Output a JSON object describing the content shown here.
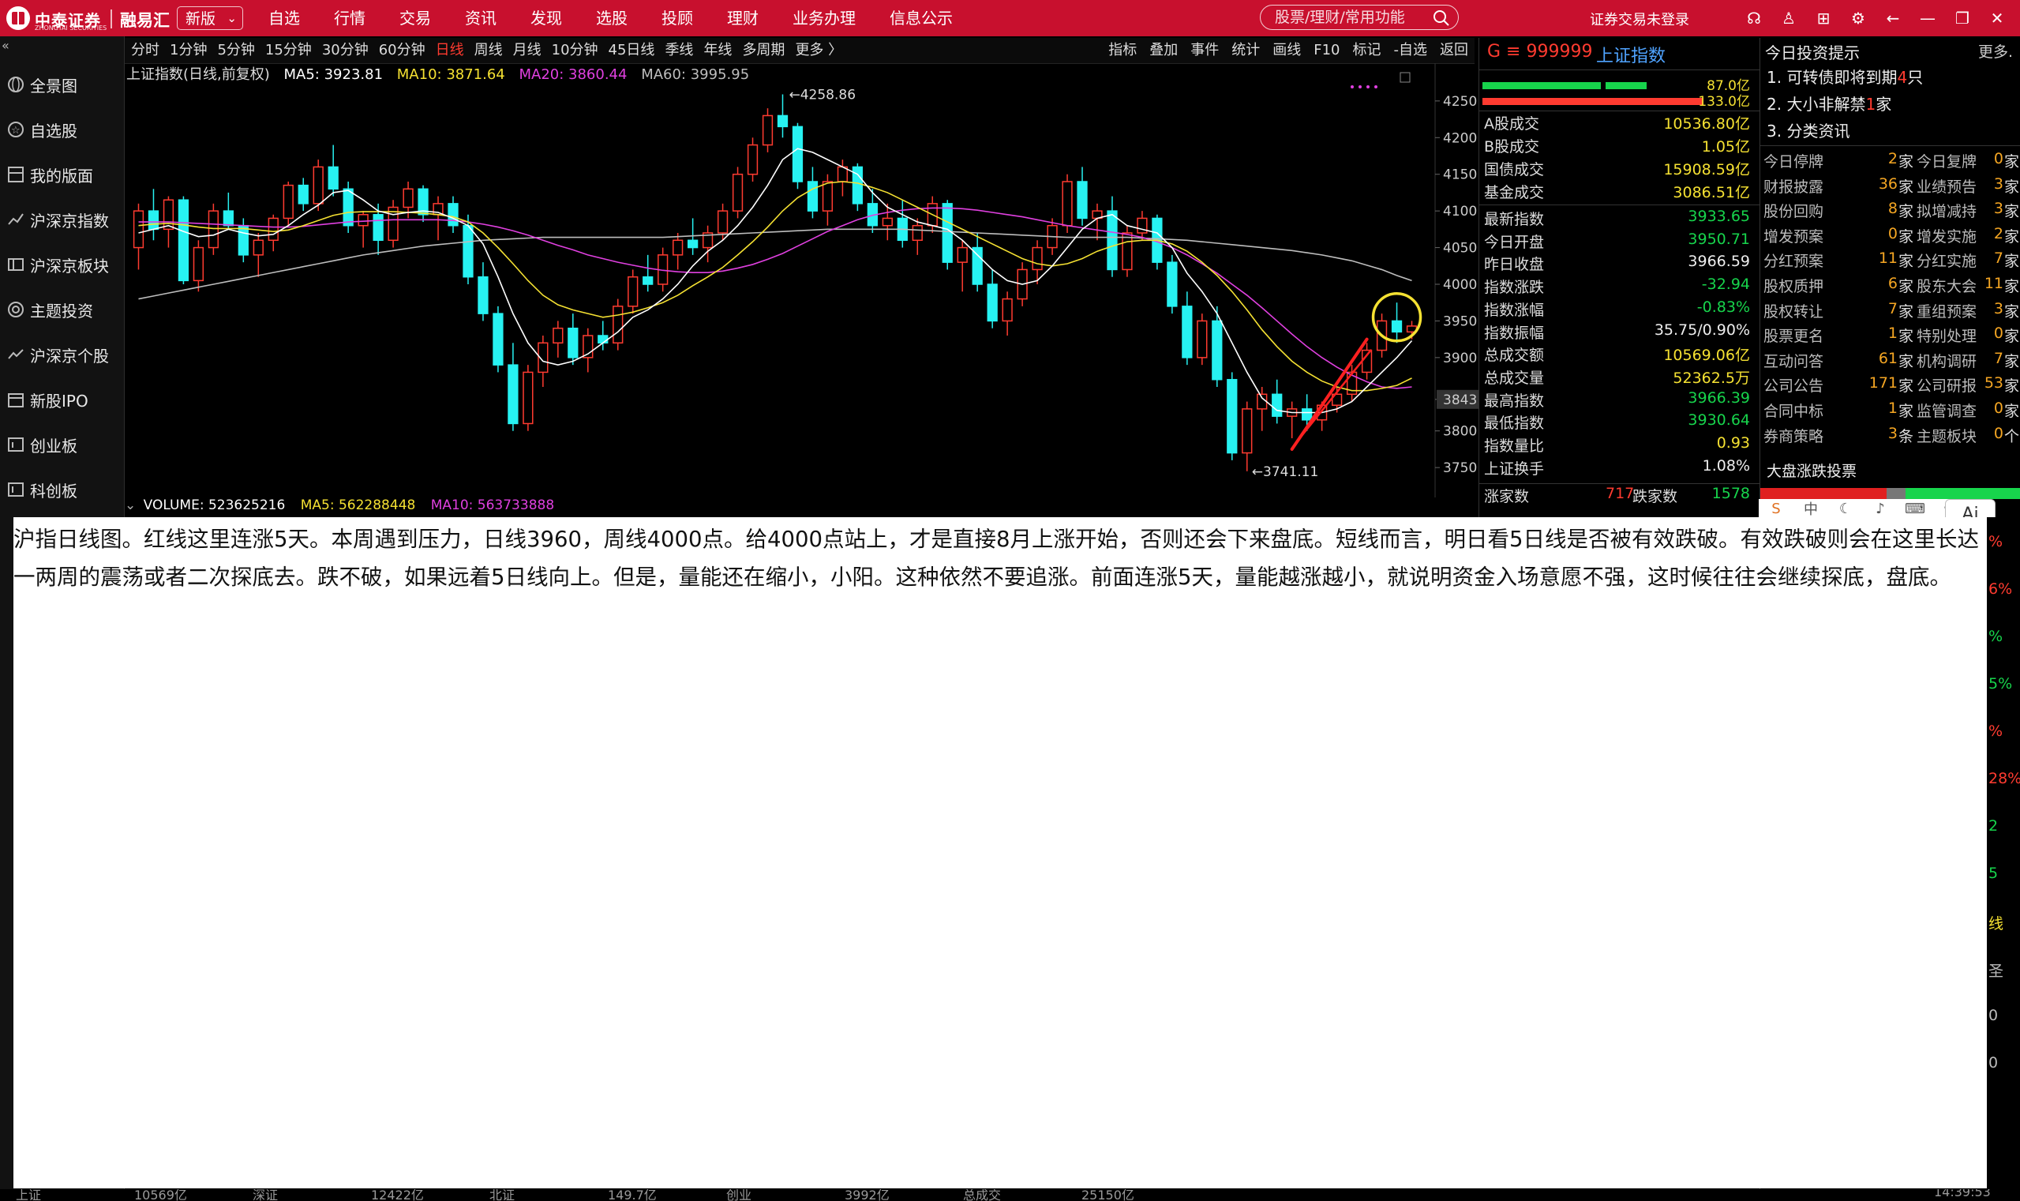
{
  "app": {
    "brand": "中泰证券",
    "brand_sub": "ZHONGTAI SECURITIES",
    "brand2": "融易汇",
    "version_select": "新版",
    "menu": [
      "自选",
      "行情",
      "交易",
      "资讯",
      "发现",
      "选股",
      "投顾",
      "理财",
      "业务办理",
      "信息公示"
    ],
    "search_placeholder": "股票/理财/常用功能",
    "login_status": "证券交易未登录"
  },
  "sidebar": {
    "items": [
      "全景图",
      "自选股",
      "我的版面",
      "沪深京指数",
      "沪深京板块",
      "主题投资",
      "沪深京个股",
      "新股IPO",
      "创业板",
      "科创板"
    ]
  },
  "chart_toolbar": {
    "periods": [
      "分时",
      "1分钟",
      "5分钟",
      "15分钟",
      "30分钟",
      "60分钟",
      "日线",
      "周线",
      "月线",
      "10分钟",
      "45日线",
      "季线",
      "年线",
      "多周期",
      "更多 〉"
    ],
    "active_period": "日线",
    "tools": [
      "指标",
      "叠加",
      "事件",
      "统计",
      "画线",
      "F10",
      "标记",
      "-自选",
      "返回"
    ]
  },
  "chart_header": {
    "title": "上证指数(日线,前复权)",
    "ma5": "MA5: 3923.81",
    "ma10": "MA10: 3871.64",
    "ma20": "MA20: 3860.44",
    "ma60": "MA60: 3995.95",
    "volume": "VOLUME: 523625216",
    "vol_ma5": "MA5: 562288448",
    "vol_ma10": "MA10: 563733888"
  },
  "chart_data": {
    "type": "candlestick",
    "ylim": [
      3720,
      4280
    ],
    "y_ticks": [
      4250,
      4200,
      4150,
      4100,
      4050,
      4000,
      3950,
      3900,
      3843.0,
      3800,
      3750
    ],
    "current_price_label": "3843.0",
    "high_label": "4258.86",
    "low_label": "3741.11",
    "annotation": "red line marking 5 up days, yellow circle around latest bars",
    "candles": [
      [
        4050,
        4110,
        4020,
        4100
      ],
      [
        4100,
        4130,
        4060,
        4075
      ],
      [
        4075,
        4120,
        4050,
        4115
      ],
      [
        4115,
        4120,
        4000,
        4005
      ],
      [
        4005,
        4060,
        3990,
        4050
      ],
      [
        4050,
        4110,
        4040,
        4100
      ],
      [
        4100,
        4125,
        4075,
        4080
      ],
      [
        4080,
        4090,
        4030,
        4040
      ],
      [
        4040,
        4070,
        4010,
        4060
      ],
      [
        4060,
        4095,
        4045,
        4090
      ],
      [
        4090,
        4140,
        4080,
        4135
      ],
      [
        4135,
        4145,
        4100,
        4110
      ],
      [
        4110,
        4170,
        4100,
        4160
      ],
      [
        4160,
        4190,
        4120,
        4130
      ],
      [
        4130,
        4140,
        4070,
        4080
      ],
      [
        4080,
        4100,
        4050,
        4095
      ],
      [
        4095,
        4110,
        4040,
        4060
      ],
      [
        4060,
        4115,
        4050,
        4105
      ],
      [
        4105,
        4140,
        4090,
        4130
      ],
      [
        4130,
        4135,
        4085,
        4095
      ],
      [
        4095,
        4120,
        4060,
        4110
      ],
      [
        4110,
        4120,
        4070,
        4080
      ],
      [
        4080,
        4095,
        4000,
        4010
      ],
      [
        4010,
        4030,
        3950,
        3960
      ],
      [
        3960,
        3970,
        3880,
        3890
      ],
      [
        3890,
        3920,
        3800,
        3810
      ],
      [
        3810,
        3890,
        3800,
        3880
      ],
      [
        3880,
        3930,
        3860,
        3920
      ],
      [
        3920,
        3950,
        3900,
        3940
      ],
      [
        3940,
        3960,
        3890,
        3900
      ],
      [
        3900,
        3940,
        3880,
        3930
      ],
      [
        3930,
        3950,
        3910,
        3920
      ],
      [
        3920,
        3980,
        3910,
        3970
      ],
      [
        3970,
        4020,
        3960,
        4010
      ],
      [
        4010,
        4040,
        3990,
        4000
      ],
      [
        4000,
        4050,
        3990,
        4040
      ],
      [
        4040,
        4070,
        4020,
        4060
      ],
      [
        4060,
        4090,
        4040,
        4050
      ],
      [
        4050,
        4080,
        4030,
        4070
      ],
      [
        4070,
        4110,
        4060,
        4100
      ],
      [
        4100,
        4160,
        4090,
        4150
      ],
      [
        4150,
        4200,
        4140,
        4190
      ],
      [
        4190,
        4240,
        4180,
        4230
      ],
      [
        4230,
        4259,
        4200,
        4215
      ],
      [
        4215,
        4220,
        4130,
        4140
      ],
      [
        4140,
        4160,
        4090,
        4100
      ],
      [
        4100,
        4150,
        4080,
        4140
      ],
      [
        4140,
        4170,
        4120,
        4160
      ],
      [
        4160,
        4165,
        4100,
        4110
      ],
      [
        4110,
        4130,
        4070,
        4080
      ],
      [
        4080,
        4110,
        4060,
        4090
      ],
      [
        4090,
        4115,
        4050,
        4060
      ],
      [
        4060,
        4090,
        4040,
        4080
      ],
      [
        4080,
        4120,
        4070,
        4110
      ],
      [
        4110,
        4115,
        4020,
        4030
      ],
      [
        4030,
        4060,
        3990,
        4050
      ],
      [
        4050,
        4070,
        3990,
        4000
      ],
      [
        4000,
        4020,
        3940,
        3950
      ],
      [
        3950,
        3990,
        3930,
        3980
      ],
      [
        3980,
        4030,
        3970,
        4020
      ],
      [
        4020,
        4060,
        4000,
        4050
      ],
      [
        4050,
        4090,
        4040,
        4080
      ],
      [
        4080,
        4150,
        4070,
        4140
      ],
      [
        4140,
        4160,
        4080,
        4090
      ],
      [
        4090,
        4110,
        4060,
        4100
      ],
      [
        4100,
        4120,
        4010,
        4020
      ],
      [
        4020,
        4080,
        4010,
        4070
      ],
      [
        4070,
        4100,
        4060,
        4090
      ],
      [
        4090,
        4095,
        4020,
        4030
      ],
      [
        4030,
        4040,
        3960,
        3970
      ],
      [
        3970,
        3990,
        3890,
        3900
      ],
      [
        3900,
        3960,
        3890,
        3950
      ],
      [
        3950,
        3970,
        3860,
        3870
      ],
      [
        3870,
        3880,
        3760,
        3770
      ],
      [
        3770,
        3840,
        3745,
        3830
      ],
      [
        3830,
        3860,
        3800,
        3850
      ],
      [
        3850,
        3870,
        3810,
        3820
      ],
      [
        3820,
        3840,
        3790,
        3830
      ],
      [
        3830,
        3850,
        3800,
        3815
      ],
      [
        3815,
        3840,
        3800,
        3835
      ],
      [
        3835,
        3860,
        3825,
        3850
      ],
      [
        3850,
        3890,
        3840,
        3880
      ],
      [
        3880,
        3920,
        3870,
        3910
      ],
      [
        3910,
        3960,
        3900,
        3950
      ],
      [
        3950,
        3975,
        3920,
        3935
      ],
      [
        3935,
        3950,
        3925,
        3943
      ]
    ],
    "ma5": [
      4070,
      4075,
      4080,
      4072,
      4065,
      4067,
      4075,
      4070,
      4066,
      4068,
      4080,
      4095,
      4108,
      4125,
      4128,
      4115,
      4100,
      4095,
      4098,
      4100,
      4098,
      4090,
      4080,
      4055,
      4010,
      3960,
      3920,
      3895,
      3890,
      3895,
      3905,
      3920,
      3935,
      3955,
      3965,
      3980,
      4000,
      4025,
      4045,
      4060,
      4080,
      4105,
      4135,
      4170,
      4185,
      4180,
      4170,
      4160,
      4150,
      4125,
      4105,
      4095,
      4085,
      4080,
      4075,
      4060,
      4040,
      4020,
      4005,
      4000,
      4005,
      4025,
      4050,
      4075,
      4090,
      4095,
      4080,
      4075,
      4070,
      4050,
      4015,
      3990,
      3960,
      3920,
      3880,
      3845,
      3828,
      3825,
      3825,
      3825,
      3830,
      3840,
      3860,
      3880,
      3900,
      3923
    ],
    "ma10": [
      4080,
      4082,
      4083,
      4081,
      4078,
      4076,
      4076,
      4076,
      4074,
      4072,
      4074,
      4080,
      4087,
      4094,
      4098,
      4099,
      4099,
      4099,
      4098,
      4097,
      4095,
      4092,
      4085,
      4070,
      4050,
      4028,
      4005,
      3985,
      3972,
      3965,
      3960,
      3955,
      3958,
      3962,
      3968,
      3975,
      3985,
      3998,
      4010,
      4023,
      4040,
      4058,
      4078,
      4100,
      4118,
      4130,
      4138,
      4140,
      4138,
      4132,
      4125,
      4115,
      4105,
      4095,
      4085,
      4075,
      4065,
      4055,
      4045,
      4035,
      4028,
      4025,
      4028,
      4035,
      4045,
      4052,
      4058,
      4060,
      4060,
      4055,
      4045,
      4030,
      4012,
      3990,
      3965,
      3938,
      3915,
      3895,
      3880,
      3868,
      3860,
      3855,
      3855,
      3858,
      3862,
      3872
    ],
    "ma20": [
      4085,
      4085,
      4085,
      4084,
      4083,
      4082,
      4081,
      4080,
      4079,
      4078,
      4078,
      4079,
      4081,
      4083,
      4085,
      4086,
      4087,
      4088,
      4088,
      4088,
      4088,
      4087,
      4085,
      4082,
      4078,
      4073,
      4067,
      4060,
      4053,
      4047,
      4040,
      4035,
      4030,
      4026,
      4022,
      4019,
      4017,
      4016,
      4016,
      4018,
      4022,
      4027,
      4034,
      4042,
      4052,
      4062,
      4072,
      4080,
      4088,
      4094,
      4098,
      4101,
      4103,
      4104,
      4104,
      4103,
      4101,
      4098,
      4095,
      4092,
      4088,
      4084,
      4080,
      4077,
      4074,
      4071,
      4068,
      4064,
      4058,
      4050,
      4040,
      4028,
      4015,
      4000,
      3985,
      3968,
      3950,
      3932,
      3915,
      3900,
      3887,
      3876,
      3867,
      3860,
      3858,
      3860
    ],
    "ma60": [
      3980,
      3984,
      3988,
      3992,
      3996,
      4000,
      4004,
      4008,
      4012,
      4016,
      4020,
      4024,
      4028,
      4032,
      4036,
      4040,
      4043,
      4046,
      4049,
      4052,
      4054,
      4056,
      4058,
      4060,
      4061,
      4062,
      4063,
      4064,
      4064,
      4064,
      4064,
      4064,
      4064,
      4064,
      4064,
      4064,
      4065,
      4066,
      4067,
      4068,
      4069,
      4070,
      4071,
      4072,
      4073,
      4074,
      4075,
      4075,
      4075,
      4075,
      4075,
      4075,
      4074,
      4073,
      4072,
      4071,
      4070,
      4069,
      4068,
      4067,
      4066,
      4065,
      4064,
      4064,
      4064,
      4064,
      4064,
      4063,
      4062,
      4061,
      4060,
      4058,
      4056,
      4054,
      4052,
      4050,
      4048,
      4046,
      4043,
      4040,
      4036,
      4032,
      4026,
      4020,
      4012,
      4005
    ]
  },
  "quote_panel": {
    "code": "999999",
    "name": "上证指数",
    "bar_vals": [
      "87.0亿",
      "133.0亿"
    ],
    "rows1": [
      {
        "label": "A股成交",
        "value": "10536.80亿"
      },
      {
        "label": "B股成交",
        "value": "1.05亿"
      },
      {
        "label": "国债成交",
        "value": "15908.59亿"
      },
      {
        "label": "基金成交",
        "value": "3086.51亿"
      }
    ],
    "rows2": [
      {
        "label": "最新指数",
        "value": "3933.65",
        "c": "green"
      },
      {
        "label": "今日开盘",
        "value": "3950.71",
        "c": "green"
      },
      {
        "label": "昨日收盘",
        "value": "3966.59",
        "c": "white"
      },
      {
        "label": "指数涨跌",
        "value": "-32.94",
        "c": "green"
      },
      {
        "label": "指数涨幅",
        "value": "-0.83%",
        "c": "green"
      },
      {
        "label": "指数振幅",
        "value": "35.75/0.90%",
        "c": "white"
      },
      {
        "label": "总成交额",
        "value": "10569.06亿",
        "c": "yellow"
      },
      {
        "label": "总成交量",
        "value": "52362.5万",
        "c": "yellow"
      },
      {
        "label": "最高指数",
        "value": "3966.39",
        "c": "green"
      },
      {
        "label": "最低指数",
        "value": "3930.64",
        "c": "green"
      },
      {
        "label": "指数量比",
        "value": "0.93",
        "c": "yellow"
      },
      {
        "label": "上证换手",
        "value": "1.08%",
        "c": "white"
      }
    ],
    "up_label": "涨家数",
    "up_count": "717",
    "down_label": "跌家数",
    "down_count": "1578"
  },
  "info_panel": {
    "title": "今日投资提示",
    "more": "更多.",
    "news": [
      {
        "pre": "1. 可转债即将到期",
        "num": "4",
        "post": "只"
      },
      {
        "pre": "2. 大小非解禁",
        "num": "1",
        "post": "家"
      },
      {
        "pre": "3. 分类资讯",
        "num": "",
        "post": ""
      }
    ],
    "rows": [
      {
        "l1": "今日停牌",
        "v1": "2",
        "u1": "家",
        "l2": "今日复牌",
        "v2": "0",
        "u2": "家"
      },
      {
        "l1": "财报披露",
        "v1": "36",
        "u1": "家",
        "l2": "业绩预告",
        "v2": "3",
        "u2": "家"
      },
      {
        "l1": "股份回购",
        "v1": "8",
        "u1": "家",
        "l2": "拟增减持",
        "v2": "3",
        "u2": "家"
      },
      {
        "l1": "增发预案",
        "v1": "0",
        "u1": "家",
        "l2": "增发实施",
        "v2": "2",
        "u2": "家"
      },
      {
        "l1": "分红预案",
        "v1": "11",
        "u1": "家",
        "l2": "分红实施",
        "v2": "7",
        "u2": "家"
      },
      {
        "l1": "股权质押",
        "v1": "6",
        "u1": "家",
        "l2": "股东大会",
        "v2": "11",
        "u2": "家"
      },
      {
        "l1": "股权转让",
        "v1": "7",
        "u1": "家",
        "l2": "重组预案",
        "v2": "3",
        "u2": "家"
      },
      {
        "l1": "股票更名",
        "v1": "1",
        "u1": "家",
        "l2": "特别处理",
        "v2": "0",
        "u2": "家"
      },
      {
        "l1": "互动问答",
        "v1": "61",
        "u1": "家",
        "l2": "机构调研",
        "v2": "7",
        "u2": "家"
      },
      {
        "l1": "公司公告",
        "v1": "171",
        "u1": "家",
        "l2": "公司研报",
        "v2": "53",
        "u2": "家"
      },
      {
        "l1": "合同中标",
        "v1": "1",
        "u1": "家",
        "l2": "监管调查",
        "v2": "0",
        "u2": "家"
      },
      {
        "l1": "券商策略",
        "v1": "3",
        "u1": "条",
        "l2": "主题板块",
        "v2": "0",
        "u2": "个"
      }
    ],
    "dapan_title": "大盘涨跌投票"
  },
  "note": {
    "text": "沪指日线图。红线这里连涨5天。本周遇到压力，日线3960，周线4000点。给4000点站上，才是直接8月上涨开始，否则还会下来盘底。短线而言，明日看5日线是否被有效跌破。有效跌破则会在这里长达一两周的震荡或者二次探底去。跌不破，如果远着5日线向上。但是，量能还在缩小，小阳。这种依然不要追涨。前面连涨5天，量能越涨越小，就说明资金入场意愿不强，这时候往往会继续探底，盘底。"
  },
  "remnants": {
    "bottom": [
      "上证",
      "10569亿",
      "深证",
      "12422亿",
      "北证",
      "149.7亿",
      "创业",
      "3992亿",
      "总成交",
      "25150亿"
    ],
    "right": [
      "%",
      "6%",
      "%",
      "5%",
      "%",
      "28%",
      "2",
      "5",
      "线",
      "圣",
      "0",
      "0"
    ],
    "clock": "14:39:53",
    "ai_label": "Ai"
  },
  "colors": {
    "up": "#ff3b30",
    "down": "#27f2f2",
    "ma5": "#ffffff",
    "ma10": "#f5e132",
    "ma20": "#e040e0",
    "ma60": "#bdbdbd",
    "brand": "#c8102e"
  }
}
